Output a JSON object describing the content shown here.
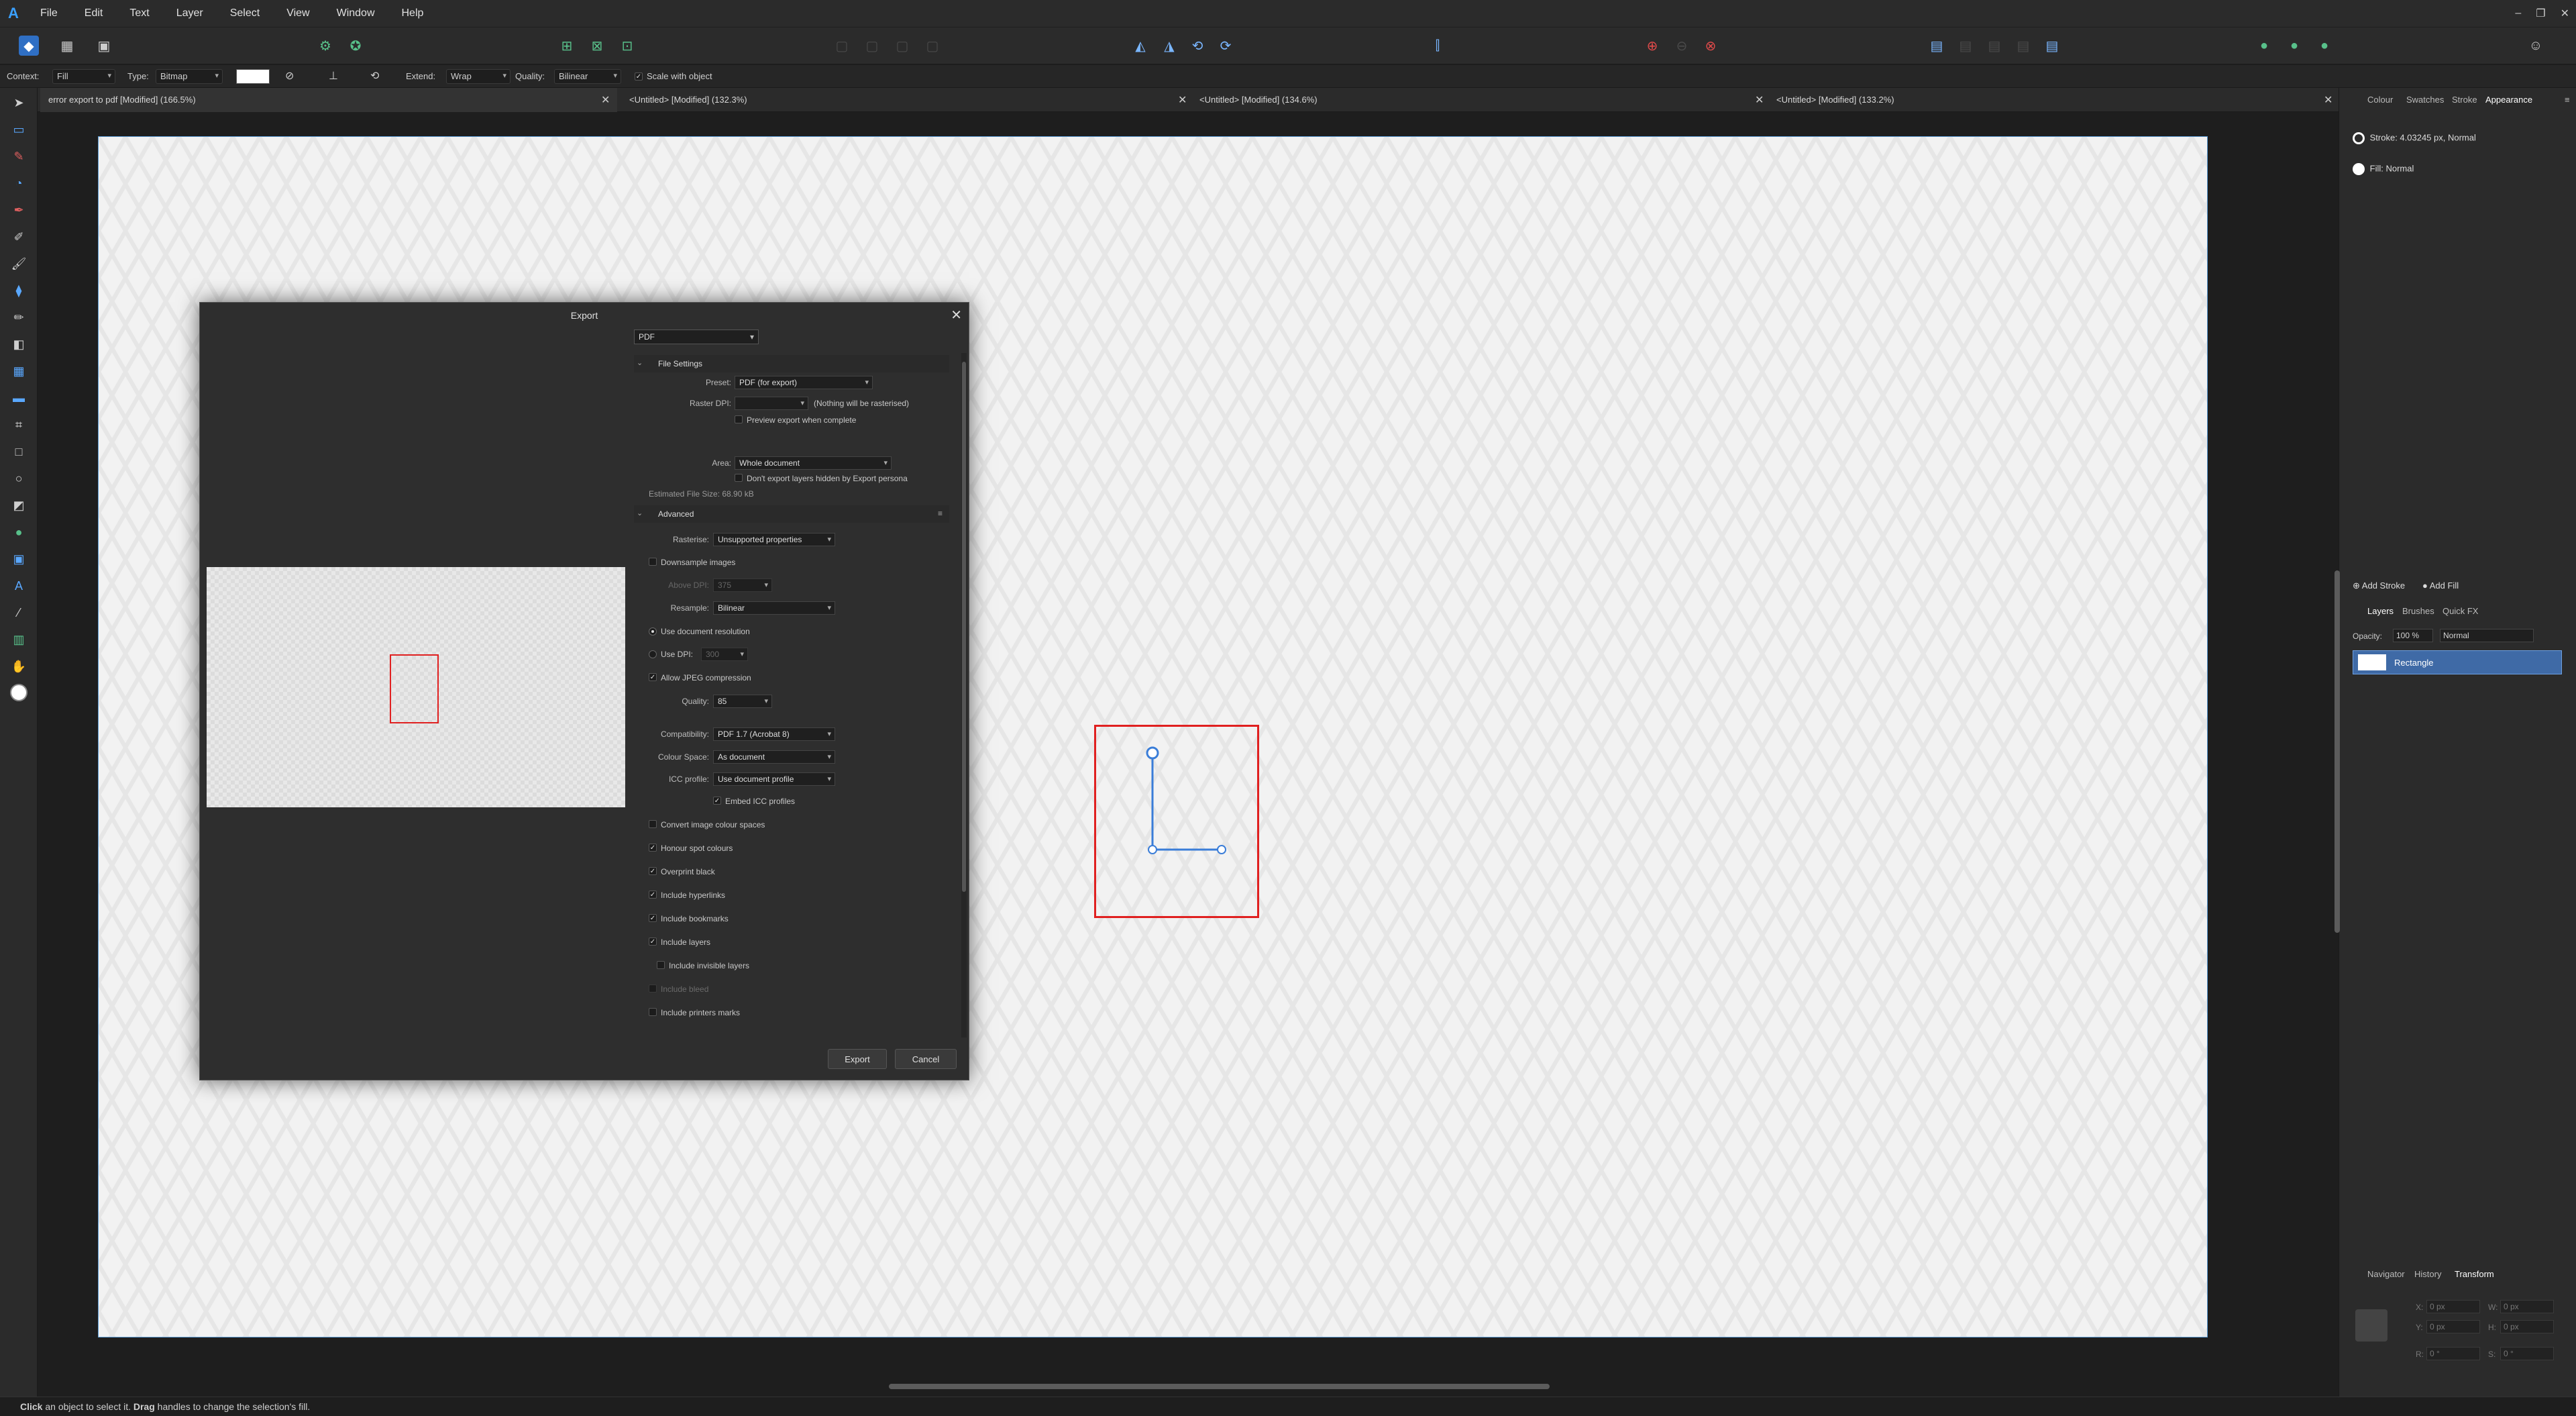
{
  "menubar": {
    "items": [
      "File",
      "Edit",
      "Text",
      "Layer",
      "Select",
      "View",
      "Window",
      "Help"
    ]
  },
  "context": {
    "context_label": "Context:",
    "context_value": "Fill",
    "type_label": "Type:",
    "type_value": "Bitmap",
    "extend_label": "Extend:",
    "extend_value": "Wrap",
    "quality_label": "Quality:",
    "quality_value": "Bilinear",
    "scale_label": "Scale with object"
  },
  "tabs": [
    {
      "label": "error export to pdf [Modified] (166.5%)"
    },
    {
      "label": "<Untitled> [Modified] (132.3%)"
    },
    {
      "label": "<Untitled> [Modified] (134.6%)"
    },
    {
      "label": "<Untitled> [Modified] (133.2%)"
    }
  ],
  "dialog": {
    "title": "Export",
    "format": "PDF",
    "file_settings": {
      "header": "File Settings",
      "preset_label": "Preset:",
      "preset_value": "PDF (for export)",
      "raster_dpi_label": "Raster DPI:",
      "raster_dpi_note": "(Nothing will be rasterised)",
      "preview_label": "Preview export when complete",
      "area_label": "Area:",
      "area_value": "Whole document",
      "hidden_layers_label": "Don't export layers hidden by Export persona",
      "est_size": "Estimated File Size: 68.90 kB"
    },
    "advanced": {
      "header": "Advanced",
      "rasterise_label": "Rasterise:",
      "rasterise_value": "Unsupported properties",
      "downsample_label": "Downsample images",
      "above_dpi_label": "Above DPI:",
      "above_dpi_value": "375",
      "resample_label": "Resample:",
      "resample_value": "Bilinear",
      "use_doc_res_label": "Use document resolution",
      "use_dpi_label": "Use DPI:",
      "use_dpi_value": "300",
      "jpeg_label": "Allow JPEG compression",
      "quality_label": "Quality:",
      "quality_value": "85",
      "compat_label": "Compatibility:",
      "compat_value": "PDF 1.7 (Acrobat 8)",
      "colour_space_label": "Colour Space:",
      "colour_space_value": "As document",
      "icc_label": "ICC profile:",
      "icc_value": "Use document profile",
      "embed_icc_label": "Embed ICC profiles",
      "checkboxes": [
        {
          "label": "Convert image colour spaces",
          "checked": false
        },
        {
          "label": "Honour spot colours",
          "checked": true
        },
        {
          "label": "Overprint black",
          "checked": true
        },
        {
          "label": "Include hyperlinks",
          "checked": true
        },
        {
          "label": "Include bookmarks",
          "checked": true
        },
        {
          "label": "Include layers",
          "checked": true
        }
      ],
      "invisible_layers_label": "Include invisible layers",
      "bleed_label": "Include bleed",
      "printers_marks_label": "Include printers marks"
    },
    "export_button": "Export",
    "cancel_button": "Cancel"
  },
  "rightpanel": {
    "tabs": [
      "Colour",
      "Swatches",
      "Stroke",
      "Appearance"
    ],
    "stroke_row": "Stroke: 4.03245 px,  Normal",
    "fill_row": "Fill:  Normal",
    "add_stroke": "Add Stroke",
    "add_fill": "Add Fill",
    "layer_tabs": [
      "Layers",
      "Brushes",
      "Quick FX"
    ],
    "opacity_label": "Opacity:",
    "opacity_value": "100 %",
    "blend_value": "Normal",
    "layer_name": "Rectangle",
    "transform_tabs": [
      "Navigator",
      "History",
      "Transform"
    ],
    "x_label": "X:",
    "x_value": "0 px",
    "y_label": "Y:",
    "y_value": "0 px",
    "w_label": "W:",
    "w_value": "0 px",
    "h_label": "H:",
    "h_value": "0 px",
    "r_label": "R:",
    "r_value": "0 °",
    "s_label": "S:",
    "s_value": "0 °"
  },
  "status": {
    "bold1": "Click",
    "text1": " an object to select it. ",
    "bold2": "Drag",
    "text2": " handles to change the selection's fill."
  },
  "colors": {
    "accent": "#3aa0ff",
    "selection_red": "#e02020",
    "layer_selected": "#3f6aa6"
  }
}
